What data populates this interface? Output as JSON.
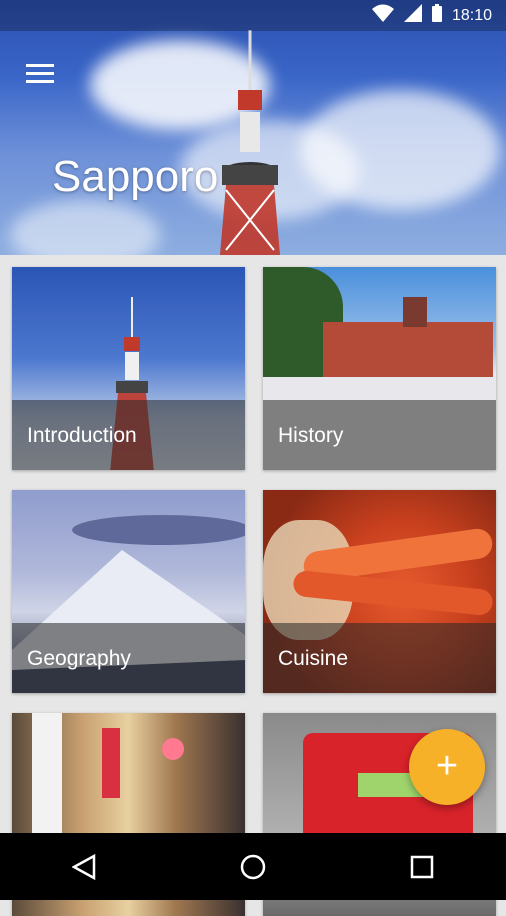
{
  "status": {
    "time": "18:10"
  },
  "hero": {
    "title": "Sapporo"
  },
  "cards": [
    {
      "label": "Introduction"
    },
    {
      "label": "History"
    },
    {
      "label": "Geography"
    },
    {
      "label": "Cuisine"
    },
    {
      "label": ""
    },
    {
      "label": ""
    }
  ],
  "fab": {
    "icon": "plus-icon"
  },
  "nav": [
    "back-icon",
    "home-icon",
    "recents-icon"
  ],
  "colors": {
    "fab": "#f6b129",
    "status_bg": "#000000"
  }
}
